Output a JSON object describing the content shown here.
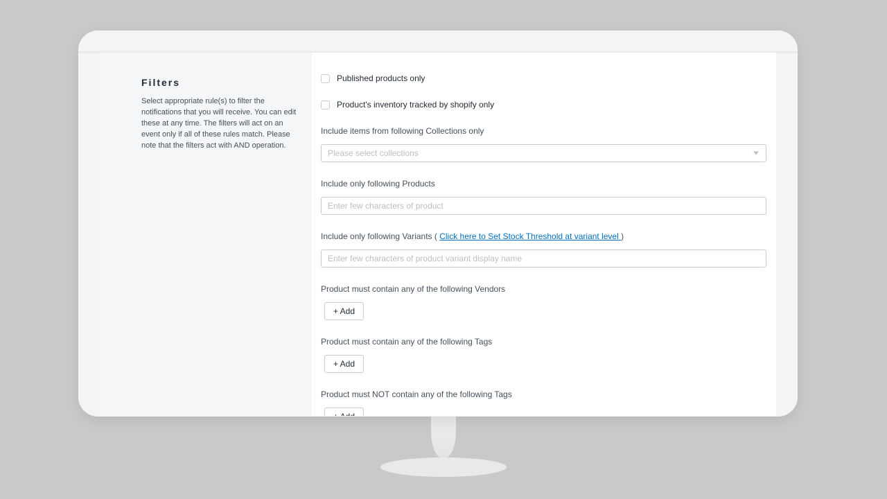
{
  "sidebar": {
    "title": "Filters",
    "description": "Select appropriate rule(s) to filter the notifications that you will receive. You can edit these at any time. The filters will act on an event only if all of these rules match. Please note that the filters act with AND operation."
  },
  "checks": {
    "published": "Published products only",
    "inventory": "Product's inventory tracked by shopify only"
  },
  "collections": {
    "label": "Include items from following Collections only",
    "placeholder": "Please select collections"
  },
  "products": {
    "label": "Include only following Products",
    "placeholder": "Enter few characters of product"
  },
  "variants": {
    "label_pre": "Include only following Variants ( ",
    "link": "Click here to Set Stock Threshold at variant level ",
    "label_post": ")",
    "placeholder": "Enter few characters of product variant display name"
  },
  "vendors": {
    "label": "Product must contain any of the following Vendors",
    "add": "+ Add"
  },
  "tags_inc": {
    "label": "Product must contain any of the following Tags",
    "add": "+ Add"
  },
  "tags_exc": {
    "label": "Product must NOT contain any of the following Tags",
    "add": "+ Add"
  }
}
